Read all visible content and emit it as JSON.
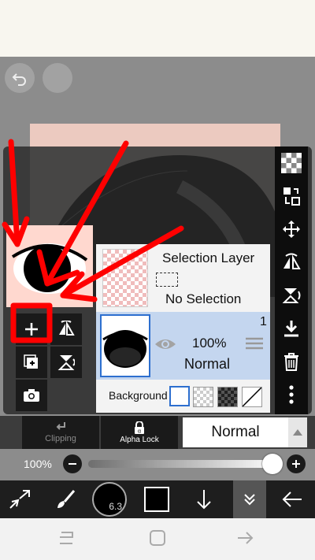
{
  "canvas": {
    "undo_icon": "undo-arrow-icon",
    "redo_icon": "redo-icon"
  },
  "layer_panel": {
    "selection_layer": {
      "title": "Selection Layer",
      "status": "No Selection"
    },
    "layer1": {
      "number": "1",
      "opacity": "100%",
      "blend": "Normal"
    },
    "background_label": "Background"
  },
  "controls": {
    "clipping_label": "Clipping",
    "alpha_lock_label": "Alpha Lock",
    "blend_mode_value": "Normal",
    "opacity_label": "100%",
    "opacity_value": 1.0
  },
  "toolbar": {
    "brush_size": "6.3"
  },
  "colors": {
    "accent": "#2d6fcf",
    "layer_selected": "#c4d6ef",
    "annotation": "#ff0000",
    "skin": "#ffd8cf",
    "panel_bg": "#1a1a1a"
  }
}
